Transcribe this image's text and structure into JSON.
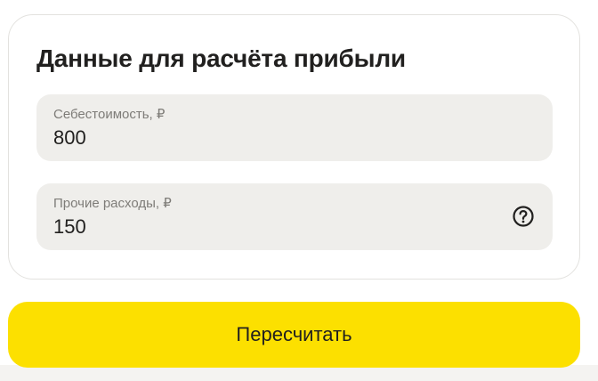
{
  "card": {
    "title": "Данные для расчёта прибыли",
    "fields": [
      {
        "label": "Себестоимость, ₽",
        "value": "800"
      },
      {
        "label": "Прочие расходы, ₽",
        "value": "150",
        "icon": "help-circle-icon"
      }
    ]
  },
  "actions": {
    "recalculate_label": "Пересчитать"
  },
  "colors": {
    "accent": "#fce000",
    "field_bg": "#efeeeb",
    "text": "#21201f",
    "label": "#7e7c78"
  }
}
